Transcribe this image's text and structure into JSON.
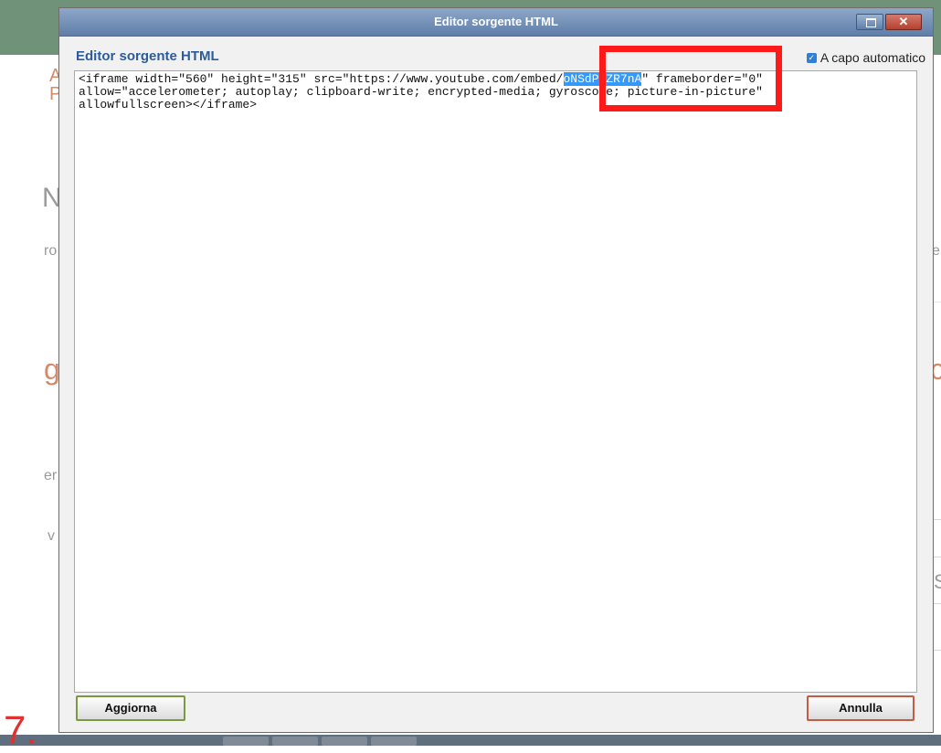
{
  "dialog": {
    "window_title": "Editor sorgente HTML",
    "heading": "Editor sorgente HTML",
    "word_wrap": {
      "label": "A capo automatico",
      "checked": true
    },
    "source": {
      "line1_before": "<iframe width=\"560\" height=\"315\" src=\"https://www.youtube.com/embed/",
      "selected": "oNSdP6ZR7nA",
      "line1_after": "\" frameborder=\"0\"",
      "line2": "allow=\"accelerometer; autoplay; clipboard-write; encrypted-media; gyroscope; picture-in-picture\"",
      "line3": "allowfullscreen></iframe>"
    },
    "buttons": {
      "update": "Aggiorna",
      "cancel": "Annulla"
    },
    "window_controls": {
      "maximize": "",
      "close": "✕"
    }
  },
  "background": {
    "fragments": [
      "A",
      "P",
      "N",
      "ro",
      "g",
      "er",
      "v",
      "e",
      "c",
      "S"
    ]
  },
  "annotation": {
    "step_number": "7.",
    "highlight_color": "#ff1a1a"
  },
  "colors": {
    "titlebar": "#6f8fb8",
    "heading": "#2b5c9b",
    "selection": "#3399ff",
    "update_border": "#7b9a3f",
    "cancel_border": "#c25c44"
  },
  "icons": {
    "maximize": "maximize-icon",
    "close": "close-icon",
    "checkbox": "checkbox-checked-icon"
  }
}
